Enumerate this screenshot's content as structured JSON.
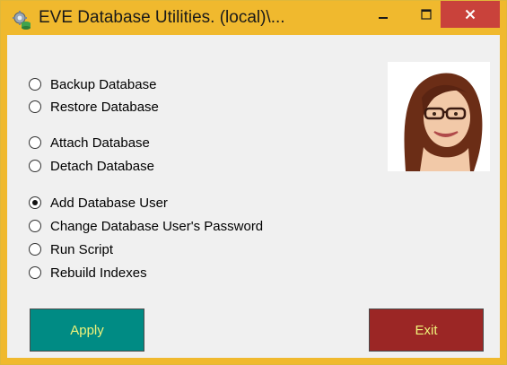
{
  "window": {
    "title": "EVE Database Utilities. (local)\\...",
    "title_icon": "gear-database-icon",
    "controls": {
      "minimize_icon": "minimize-icon",
      "maximize_icon": "maximize-icon",
      "close_icon": "close-icon",
      "close_color": "#c9423b"
    },
    "title_bar_color": "#f0b92e"
  },
  "options": [
    {
      "label": "Backup Database",
      "checked": false
    },
    {
      "label": "Restore Database",
      "checked": false
    },
    {
      "label": "Attach Database",
      "checked": false
    },
    {
      "label": "Detach Database",
      "checked": false
    },
    {
      "label": "Add Database User",
      "checked": true
    },
    {
      "label": "Change Database User's Password",
      "checked": false
    },
    {
      "label": "Run Script",
      "checked": false
    },
    {
      "label": "Rebuild Indexes",
      "checked": false
    }
  ],
  "photo": {
    "subject": "woman-with-glasses-avatar"
  },
  "buttons": {
    "apply_label": "Apply",
    "apply_color": "#008b84",
    "exit_label": "Exit",
    "exit_color": "#9b2625",
    "label_color": "#f0f37a"
  }
}
